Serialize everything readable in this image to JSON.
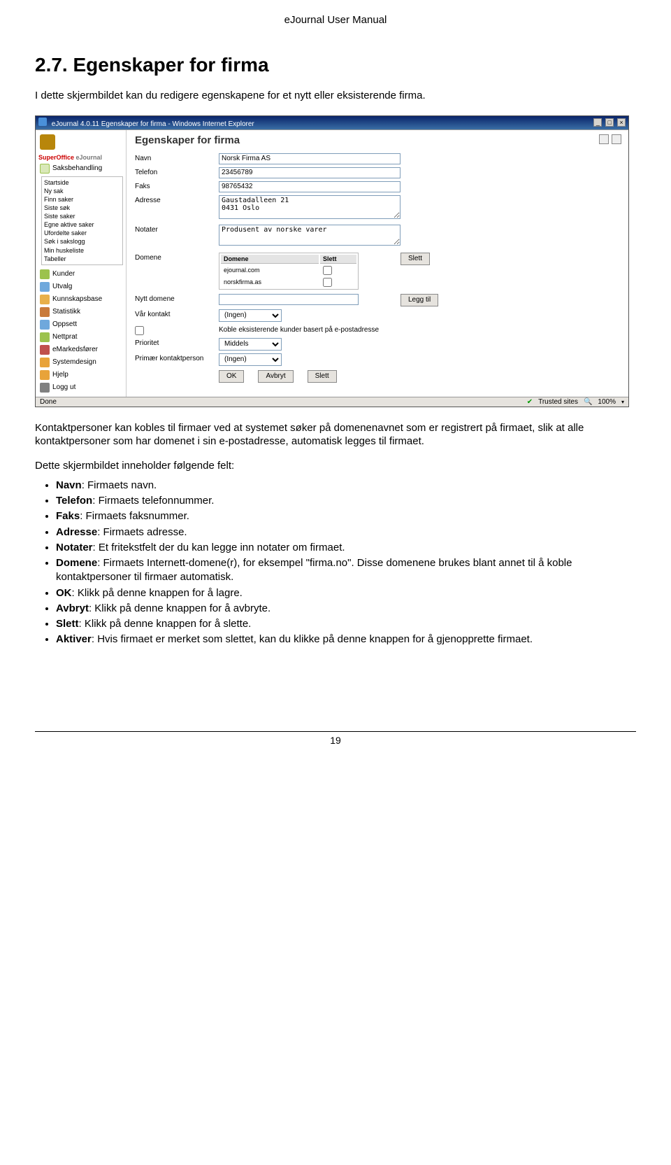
{
  "manual_header": "eJournal User Manual",
  "section_title": "2.7. Egenskaper for firma",
  "intro_text": "I dette skjermbildet kan du redigere egenskapene for et nytt eller eksisterende firma.",
  "screenshot": {
    "window_title": "eJournal 4.0.11 Egenskaper for firma - Windows Internet Explorer",
    "brand_part1": "SuperOffice",
    "brand_part2": "eJournal",
    "sidebar": {
      "group1": "Saksbehandling",
      "group1_items": [
        "Startside",
        "Ny sak",
        "Finn saker",
        "Siste søk",
        "Siste saker",
        "Egne aktive saker",
        "Ufordelte saker",
        "Søk i sakslogg",
        "Min huskeliste",
        "Tabeller"
      ],
      "others": [
        "Kunder",
        "Utvalg",
        "Kunnskapsbase",
        "Statistikk",
        "Oppsett",
        "Nettprat",
        "eMarkedsfører",
        "Systemdesign",
        "Hjelp",
        "Logg ut"
      ],
      "colors": [
        "#9cc24d",
        "#6fa8dc",
        "#e8b04a",
        "#c97a3a",
        "#6fa8dc",
        "#9cc24d",
        "#c0504d",
        "#e8a33a",
        "#e8a33a",
        "#808080"
      ]
    },
    "form": {
      "title": "Egenskaper for firma",
      "navn_label": "Navn",
      "navn_value": "Norsk Firma AS",
      "telefon_label": "Telefon",
      "telefon_value": "23456789",
      "faks_label": "Faks",
      "faks_value": "98765432",
      "adresse_label": "Adresse",
      "adresse_value": "Gaustadalleen 21\n0431 Oslo",
      "notater_label": "Notater",
      "notater_value": "Produsent av norske varer",
      "domene_label": "Domene",
      "domene_th1": "Domene",
      "domene_th2": "Slett",
      "domene_row1": "ejournal.com",
      "domene_row2": "norskfirma.as",
      "slett_btn": "Slett",
      "nytt_domene_label": "Nytt domene",
      "legg_til_btn": "Legg til",
      "vaar_kontakt_label": "Vår kontakt",
      "vaar_kontakt_value": "(Ingen)",
      "koble_label": "Koble eksisterende kunder basert på e-postadresse",
      "prioritet_label": "Prioritet",
      "prioritet_value": "Middels",
      "primaer_label": "Primær kontaktperson",
      "primaer_value": "(Ingen)",
      "ok_btn": "OK",
      "avbryt_btn": "Avbryt",
      "slett2_btn": "Slett"
    },
    "status_done": "Done",
    "status_trust": "Trusted sites",
    "status_zoom": "100%"
  },
  "post_para": "Kontaktpersoner kan kobles til firmaer ved at systemet søker på domenenavnet som er registrert på firmaet, slik at alle kontaktpersoner som har domenet i sin e-postadresse, automatisk legges til firmaet.",
  "fields_intro": "Dette skjermbildet inneholder følgende felt:",
  "field_list": [
    {
      "b": "Navn",
      "t": ": Firmaets navn."
    },
    {
      "b": "Telefon",
      "t": ": Firmaets telefonnummer."
    },
    {
      "b": "Faks",
      "t": ": Firmaets faksnummer."
    },
    {
      "b": "Adresse",
      "t": ": Firmaets adresse."
    },
    {
      "b": "Notater",
      "t": ": Et fritekstfelt der du kan legge inn notater om firmaet."
    },
    {
      "b": "Domene",
      "t": ": Firmaets Internett-domene(r), for eksempel \"firma.no\". Disse domenene brukes blant annet til å koble kontaktpersoner til firmaer automatisk."
    },
    {
      "b": "OK",
      "t": ": Klikk på denne knappen for å lagre."
    },
    {
      "b": "Avbryt",
      "t": ": Klikk på denne knappen for å avbryte."
    },
    {
      "b": "Slett",
      "t": ": Klikk på denne knappen for å slette."
    },
    {
      "b": "Aktiver",
      "t": ": Hvis firmaet er merket som slettet, kan du klikke på denne knappen for å gjenopprette firmaet."
    }
  ],
  "page_number": "19"
}
